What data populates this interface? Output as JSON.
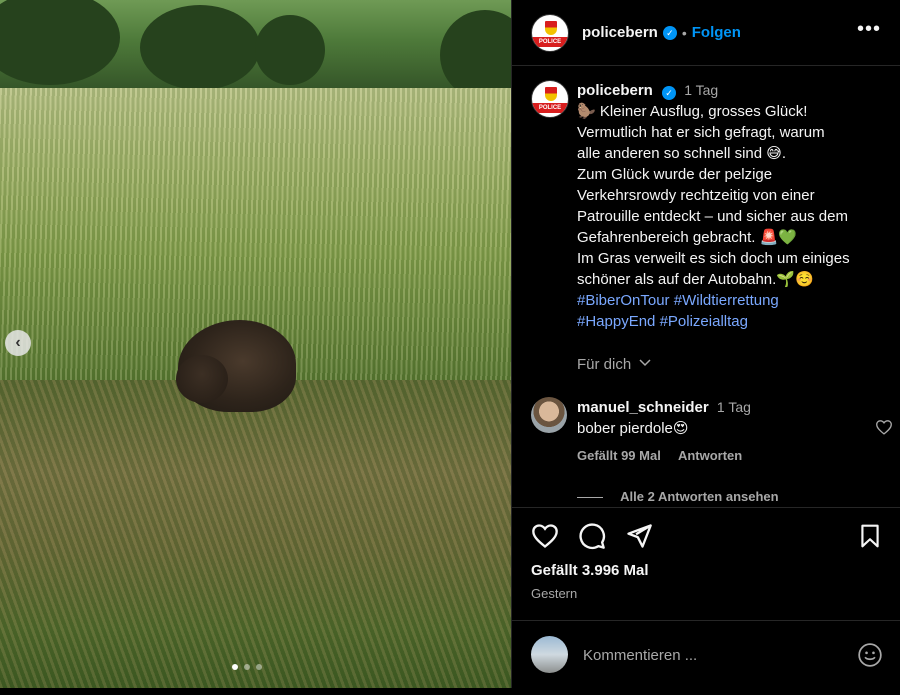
{
  "post": {
    "username": "policebern",
    "follow_label": "Folgen",
    "separator": "•",
    "more_label": "•••",
    "avatar_band_text": "POLICE",
    "carousel_prev_label": "‹"
  },
  "caption": {
    "username": "policebern",
    "time": "1 Tag",
    "lines": [
      "🦫 Kleiner Ausflug, grosses Glück!",
      "Vermutlich hat er sich gefragt, warum",
      "alle anderen so schnell sind 😅.",
      "Zum Glück wurde der pelzige",
      "Verkehrsrowdy rechtzeitig von einer",
      "Patrouille entdeckt – und sicher aus dem",
      "Gefahrenbereich gebracht. 🚨💚",
      "Im Gras verweilt es sich doch um einiges",
      "schöner als auf der Autobahn.🌱☺️"
    ],
    "hashtags_line1": [
      "#BiberOnTour",
      "#Wildtierrettung"
    ],
    "hashtags_line2": [
      "#HappyEnd",
      "#Polizeialltag"
    ],
    "for_you_label": "Für dich"
  },
  "comment": {
    "username": "manuel_schneider",
    "time": "1 Tag",
    "text": "bober pierdole😍",
    "likes_label": "Gefällt 99 Mal",
    "reply_label": "Antworten",
    "view_replies_label": "Alle 2 Antworten ansehen"
  },
  "footer": {
    "likes": "Gefällt 3.996 Mal",
    "date": "Gestern",
    "comment_placeholder": "Kommentieren ..."
  },
  "icons": {
    "like": "heart-icon",
    "comment": "comment-icon",
    "share": "paper-plane-icon",
    "save": "bookmark-icon",
    "emoji": "smiley-icon",
    "verified": "verified-badge-icon"
  },
  "colors": {
    "accent": "#0095f6",
    "hashtag": "#7aa8ff",
    "muted": "#a8a8a8",
    "background": "#000000"
  },
  "carousel": {
    "total": 3,
    "active_index": 0
  }
}
